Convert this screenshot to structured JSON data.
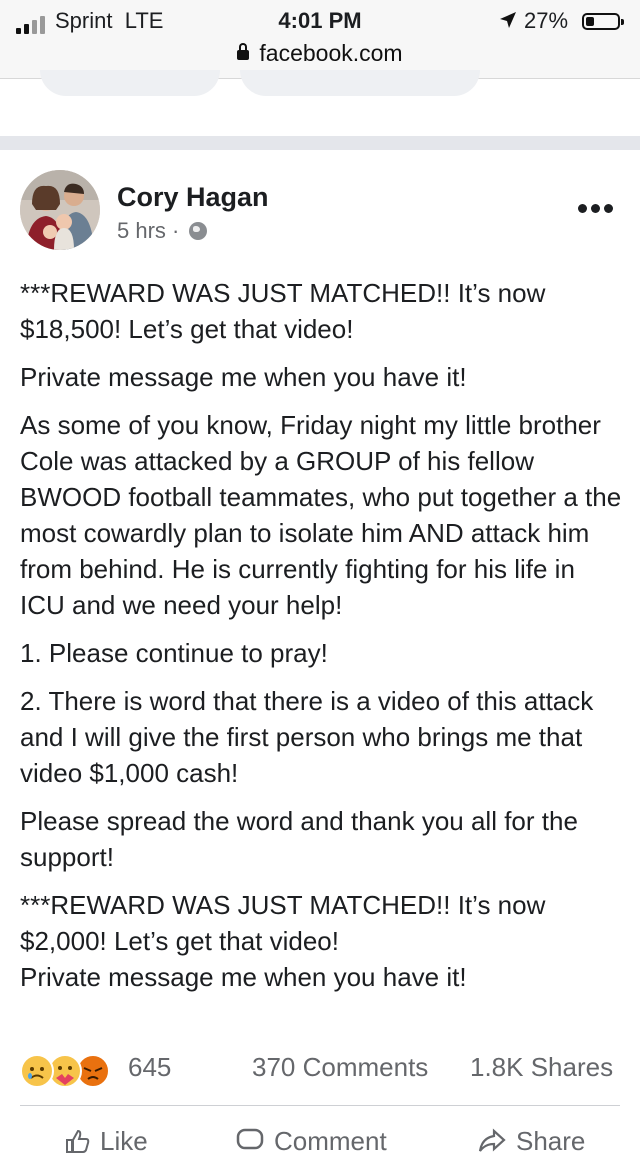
{
  "status_bar": {
    "carrier": "Sprint",
    "network": "LTE",
    "time": "4:01 PM",
    "battery_percent": "27%",
    "battery_level": 0.27
  },
  "browser": {
    "url": "facebook.com"
  },
  "post": {
    "author": "Cory Hagan",
    "time_ago": "5 hrs",
    "audience_icon": "globe-icon",
    "paragraphs": [
      "***REWARD WAS JUST MATCHED!! It’s now $18,500! Let’s get that video!",
      "Private message me when you have it!",
      "As some of you know, Friday night my little brother Cole was attacked by a GROUP of his fellow BWOOD football teammates, who put together a the most cowardly plan to isolate him AND attack him from behind. He is currently fighting for his life in ICU and we need your help!",
      "1. Please continue to pray!",
      "2. There is word that there is a video of this attack and I will give the first person who brings me that video $1,000 cash!",
      "Please spread the word and thank you all for the support!",
      "***REWARD WAS JUST MATCHED!! It’s now $2,000! Let’s get that video!\nPrivate message me when you have it!"
    ],
    "reactions": {
      "icons": [
        "sad-icon",
        "care-icon",
        "angry-icon"
      ],
      "count": "645"
    },
    "comments": "370 Comments",
    "shares": "1.8K Shares",
    "actions": [
      "Like",
      "Comment",
      "Share"
    ]
  },
  "colors": {
    "text": "#1c1e21",
    "secondary_text": "#65676b",
    "divider": "#e4e6eb"
  }
}
